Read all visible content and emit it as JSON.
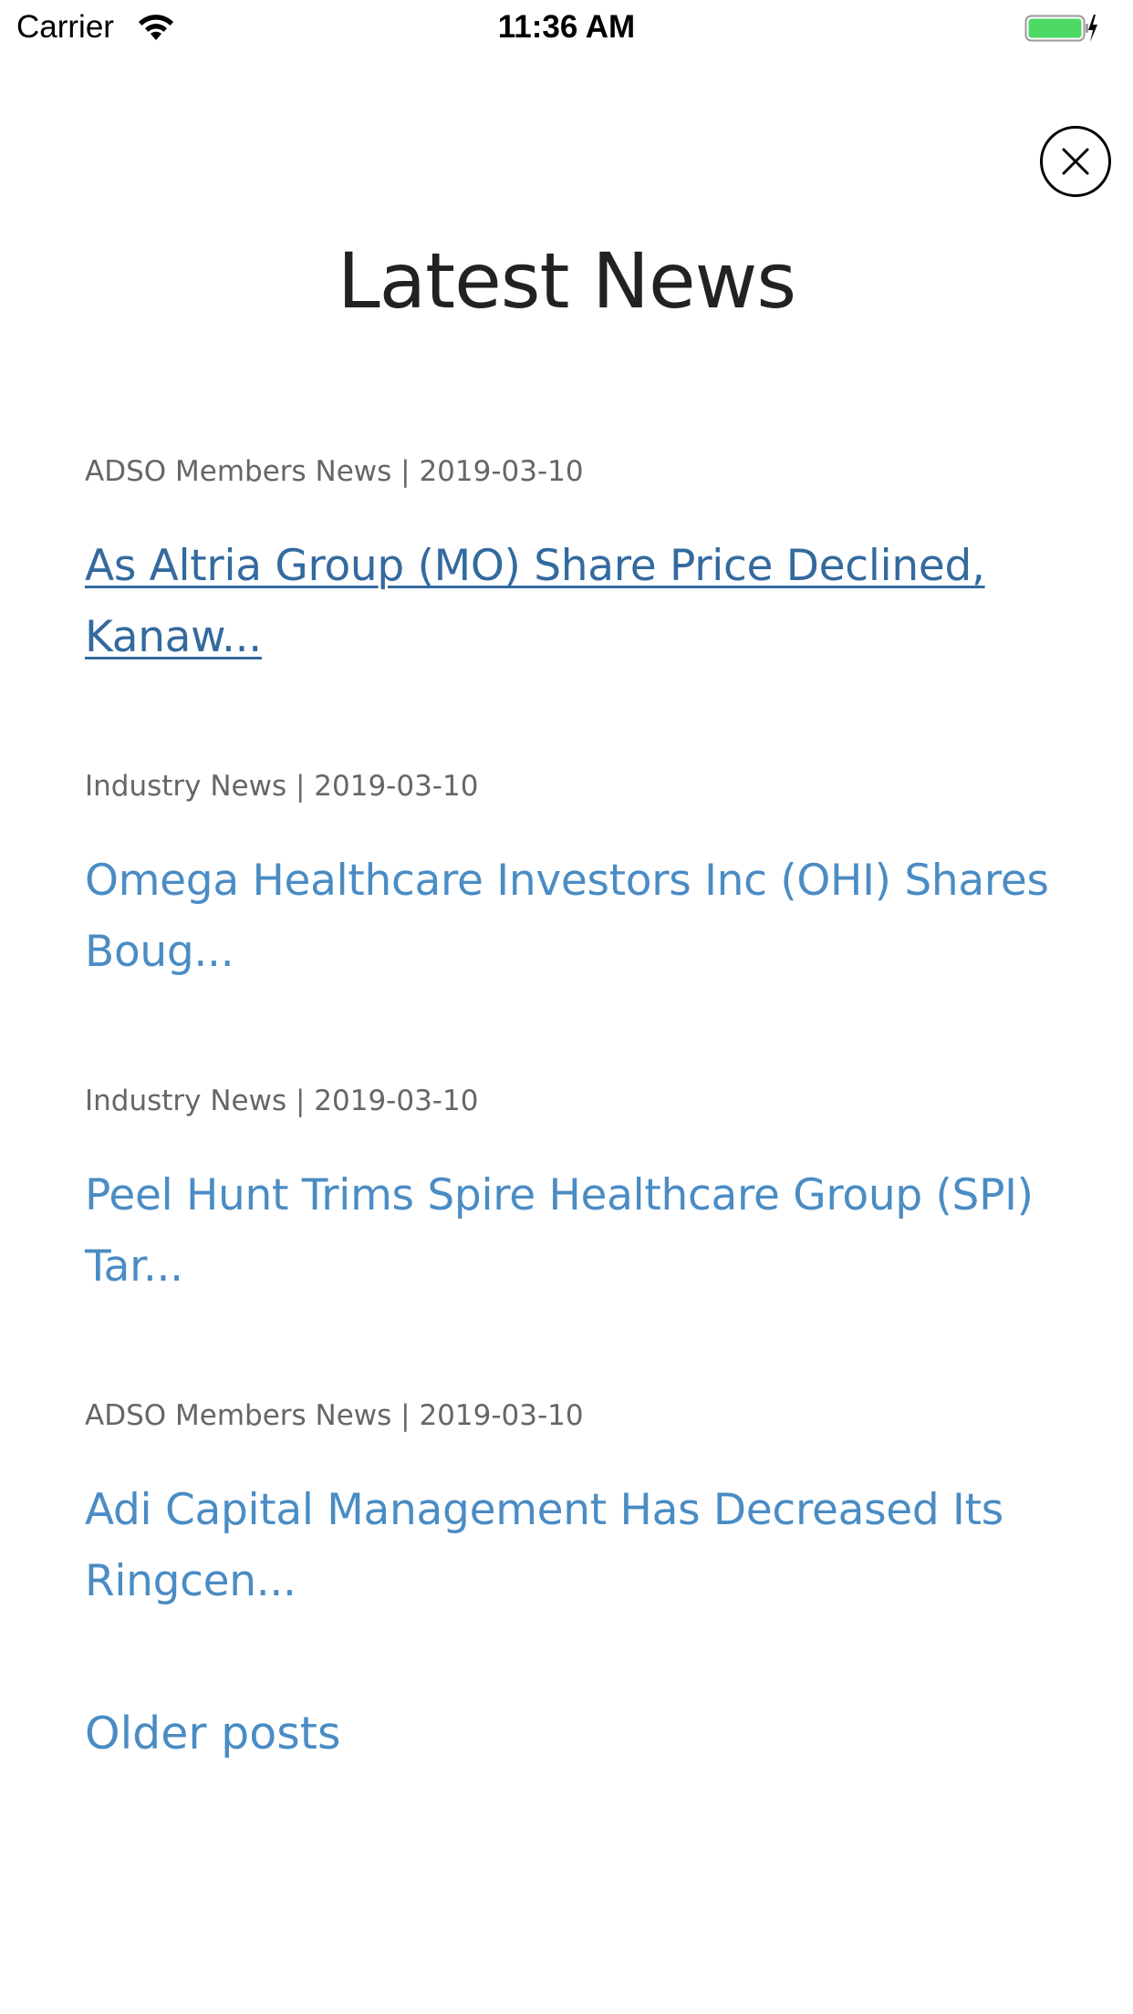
{
  "status_bar": {
    "carrier": "Carrier",
    "time": "11:36 AM",
    "wifi_icon": "wifi-icon",
    "battery_icon": "battery-charging-icon",
    "battery_color": "#4cd964"
  },
  "close_icon": "close-icon",
  "page_title": "Latest News",
  "colors": {
    "link": "#4a8cc4",
    "link_active": "#336a9e",
    "meta": "#666666",
    "title": "#222222"
  },
  "news": [
    {
      "meta": "ADSO Members News | 2019-03-10",
      "title": "As Altria Group (MO) Share Price Declined, Kanaw..."
    },
    {
      "meta": "Industry News | 2019-03-10",
      "title": "Omega Healthcare Investors Inc (OHI) Shares Boug..."
    },
    {
      "meta": "Industry News | 2019-03-10",
      "title": "Peel Hunt Trims Spire Healthcare Group (SPI) Tar..."
    },
    {
      "meta": "ADSO Members News | 2019-03-10",
      "title": "Adi Capital Management Has Decreased Its Ringcen..."
    }
  ],
  "older_posts_label": "Older posts"
}
